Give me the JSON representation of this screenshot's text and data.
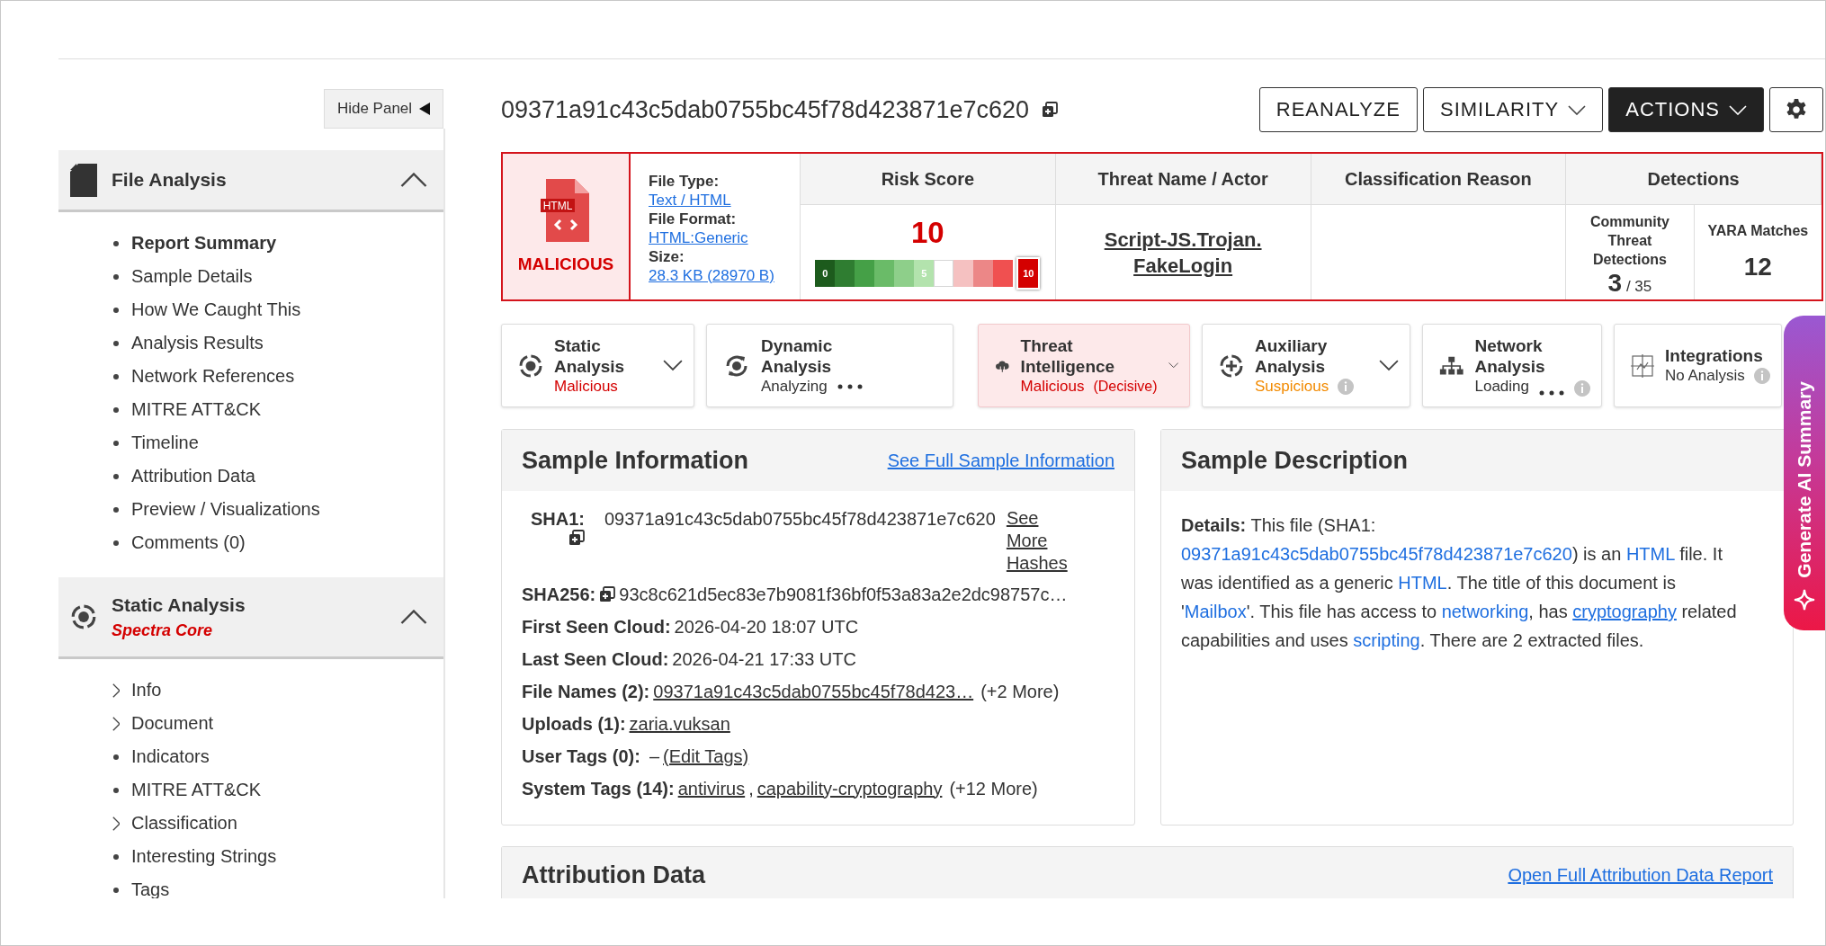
{
  "sidebar": {
    "hide_button": "Hide Panel",
    "sections": [
      {
        "kind": "file",
        "title": "File Analysis",
        "expanded": true,
        "items": [
          {
            "label": "Report Summary",
            "kind": "bullet",
            "selected": true
          },
          {
            "label": "Sample Details",
            "kind": "bullet",
            "selected": false
          },
          {
            "label": "How We Caught This",
            "kind": "bullet",
            "selected": false
          },
          {
            "label": "Analysis Results",
            "kind": "bullet",
            "selected": false
          },
          {
            "label": "Network References",
            "kind": "bullet",
            "selected": false
          },
          {
            "label": "MITRE ATT&CK",
            "kind": "bullet",
            "selected": false
          },
          {
            "label": "Timeline",
            "kind": "bullet",
            "selected": false
          },
          {
            "label": "Attribution Data",
            "kind": "bullet",
            "selected": false
          },
          {
            "label": "Preview / Visualizations",
            "kind": "bullet",
            "selected": false
          },
          {
            "label": "Comments (0)",
            "kind": "bullet",
            "selected": false
          }
        ]
      },
      {
        "kind": "static",
        "title": "Static Analysis",
        "subtitle": "Spectra Core",
        "expanded": true,
        "items": [
          {
            "label": "Info",
            "kind": "expandable",
            "selected": false
          },
          {
            "label": "Document",
            "kind": "expandable",
            "selected": false
          },
          {
            "label": "Indicators",
            "kind": "bullet",
            "selected": false
          },
          {
            "label": "MITRE ATT&CK",
            "kind": "bullet",
            "selected": false
          },
          {
            "label": "Classification",
            "kind": "expandable",
            "selected": false
          },
          {
            "label": "Interesting Strings",
            "kind": "bullet",
            "selected": false
          },
          {
            "label": "Tags",
            "kind": "bullet",
            "selected": false
          }
        ]
      }
    ]
  },
  "header": {
    "hash": "09371a91c43c5dab0755bc45f78d423871e7c620",
    "buttons": [
      {
        "label": "REANALYZE",
        "kind": "plain"
      },
      {
        "label": "SIMILARITY",
        "kind": "dropdown"
      },
      {
        "label": "ACTIONS",
        "kind": "primary-dropdown"
      },
      {
        "kind": "settings"
      }
    ]
  },
  "summary": {
    "file_badge": "HTML",
    "verdict": "MALICIOUS",
    "file_info": [
      {
        "label": "File Type:",
        "value": "Text / HTML"
      },
      {
        "label": "File Format:",
        "value": "HTML:Generic"
      },
      {
        "label": "Size:",
        "value": "28.3 KB (28970 B)"
      }
    ],
    "columns": [
      "Risk Score",
      "Threat Name / Actor",
      "Classification Reason",
      "Detections"
    ],
    "risk": {
      "score": "10",
      "scale_labels": [
        "0",
        "5",
        "10"
      ]
    },
    "threat_name": "Script-JS.Trojan.FakeLogin",
    "detections": [
      {
        "label": "Community Threat Detections",
        "value": "3",
        "total": "/ 35"
      },
      {
        "label": "YARA Matches",
        "value": "12"
      }
    ]
  },
  "analysis_tabs": [
    {
      "kind": "static",
      "title": "Static Analysis",
      "status": "Malicious",
      "color": "#d40000",
      "selected": false,
      "dropdown": true,
      "busy": false,
      "info": false
    },
    {
      "kind": "dynamic",
      "title": "Dynamic Analysis",
      "status": "Analyzing",
      "color": "#333333",
      "selected": false,
      "dropdown": false,
      "busy": true,
      "info": false
    },
    {
      "kind": "threat",
      "title": "Threat Intelligence",
      "status": "Malicious",
      "note": "(Decisive)",
      "color": "#d40000",
      "selected": true,
      "dropdown": true,
      "busy": false,
      "info": false
    },
    {
      "kind": "auxiliary",
      "title": "Auxiliary Analysis",
      "status": "Suspicious",
      "color": "#f28a00",
      "selected": false,
      "dropdown": true,
      "busy": false,
      "info": true
    },
    {
      "kind": "network",
      "title": "Network Analysis",
      "status": "Loading",
      "color": "#333333",
      "selected": false,
      "dropdown": false,
      "busy": true,
      "info": true
    },
    {
      "kind": "integrations",
      "title": "Integrations",
      "status": "No Analysis",
      "color": "#333333",
      "selected": false,
      "dropdown": false,
      "busy": false,
      "info": true
    }
  ],
  "sample_information": {
    "title": "Sample Information",
    "link": "See Full Sample Information",
    "rows": [
      {
        "kind": "sha1",
        "label": "SHA1:",
        "value": "09371a91c43c5dab0755bc45f78d423871e7c620",
        "copy": true,
        "link": "See More Hashes"
      },
      {
        "kind": "plain",
        "label": "SHA256:",
        "value": "93c8c621d5ec83e7b9081f36bf0f53a83a2e2dc98757c…",
        "copy": true
      },
      {
        "kind": "plain",
        "label": "First Seen Cloud:",
        "value": "2026-04-20 18:07 UTC"
      },
      {
        "kind": "plain",
        "label": "Last Seen Cloud:",
        "value": "2026-04-21 17:33 UTC"
      },
      {
        "kind": "links",
        "label": "File Names (2):",
        "links": [
          {
            "text": "09371a91c43c5dab0755bc45f78d423…"
          }
        ],
        "extra": "(+2 More)"
      },
      {
        "kind": "links",
        "label": "Uploads (1):",
        "links": [
          {
            "text": "zaria.vuksan"
          }
        ]
      },
      {
        "kind": "links",
        "label": "User Tags (0):",
        "empty_marker": "–",
        "links": [
          {
            "text": "(Edit Tags)"
          }
        ]
      },
      {
        "kind": "links",
        "label": "System Tags (14):",
        "links": [
          {
            "text": "antivirus",
            "suffix": ","
          },
          {
            "text": "capability-cryptography"
          }
        ],
        "extra": "(+12 More)"
      }
    ]
  },
  "sample_description": {
    "title": "Sample Description",
    "segments": [
      {
        "kind": "bold",
        "text": "Details:"
      },
      {
        "kind": "text",
        "text": " This file (SHA1: "
      },
      {
        "kind": "link",
        "text": "09371a91c43c5dab0755bc45f78d423871e7c620"
      },
      {
        "kind": "text",
        "text": ") is an "
      },
      {
        "kind": "link",
        "text": "HTML"
      },
      {
        "kind": "text",
        "text": " file. It was identified as a generic "
      },
      {
        "kind": "link",
        "text": "HTML"
      },
      {
        "kind": "text",
        "text": ". The title of this document is '"
      },
      {
        "kind": "link",
        "text": "Mailbox"
      },
      {
        "kind": "text",
        "text": "'. This file has access to "
      },
      {
        "kind": "link",
        "text": "networking"
      },
      {
        "kind": "text",
        "text": ", has "
      },
      {
        "kind": "underlined-link",
        "text": "cryptography"
      },
      {
        "kind": "text",
        "text": " related capabilities and uses "
      },
      {
        "kind": "link",
        "text": "scripting"
      },
      {
        "kind": "text",
        "text": ". There are 2 extracted files."
      }
    ]
  },
  "attribution": {
    "title": "Attribution Data",
    "link": "Open Full Attribution Data Report"
  },
  "ai_tab": {
    "label": "Generate AI Summary"
  }
}
